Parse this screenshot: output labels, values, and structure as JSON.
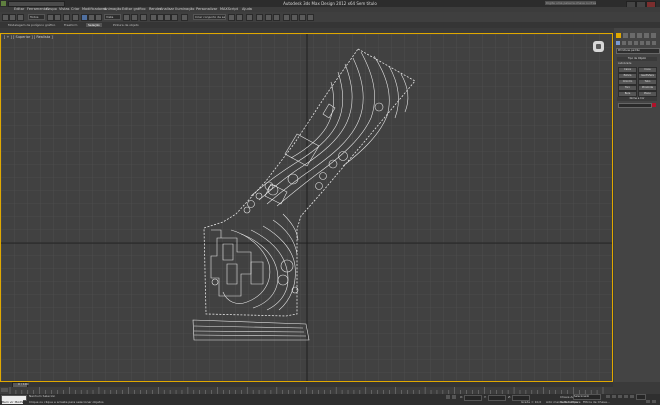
{
  "window": {
    "title": "Autodesk 3ds Max Design 2012 x64    Sem titulo",
    "search_placeholder": "Digite uma palavra-chave ou frase"
  },
  "menu": [
    "Editar",
    "Ferramentas",
    "Grupo",
    "Vistas",
    "Criar",
    "Modificadores",
    "Animação",
    "Editor gráfico",
    "Render",
    "Analisar Iluminação",
    "Personalizar",
    "MAXScript",
    "Ajuda"
  ],
  "toolbar": {
    "filter_select": "Todos",
    "view_select": "Vista",
    "selection_set": "Criar conjunto de seleç"
  },
  "ribbon": {
    "tabs": [
      "Modelagem de polígono gráfico",
      "Freeform",
      "Seleção",
      "Pintura de objeto"
    ],
    "active_index": 2
  },
  "viewport": {
    "label": "[ + ] [ Superior ] [ Realista ]",
    "active_border_color": "#e0a800",
    "grid_color": "#545454",
    "drawing_color": "#e6e6e6"
  },
  "command_panel": {
    "dropdown": "Primitivas padrão",
    "rollout_type": "Tipo de Objeto",
    "autogrid_label": "AutoGrade",
    "objects": [
      "Caixa",
      "Cone",
      "Esfera",
      "GeoEsfera",
      "Cilindro",
      "Tubo",
      "Toro",
      "Pirâmide",
      "Bule",
      "Plano"
    ],
    "rollout_name": "Nome e Cor",
    "swatch_color": "#b0122a"
  },
  "timeline": {
    "frame_label": "0 / 100",
    "ticks": [
      "0",
      "5",
      "10",
      "15",
      "20",
      "25",
      "30",
      "35",
      "40",
      "45",
      "50",
      "55",
      "60",
      "65",
      "70",
      "75",
      "80",
      "85",
      "90",
      "95",
      "100"
    ]
  },
  "status": {
    "listener": "Bem vir MAXS",
    "selection": "Nenhum Selecion",
    "prompt": "Clique ou clique e arraste para selecionar objetos",
    "coord_x_label": "X:",
    "coord_y_label": "Y:",
    "coord_z_label": "Z:",
    "grid": "Grade = 10,0",
    "autokey": "Chave Aut",
    "selected": "Selecionado",
    "set_key": "Definir Chave",
    "key_filters": "Filtros de Chave...",
    "add_time_tag": "Adic marca de tempo"
  }
}
